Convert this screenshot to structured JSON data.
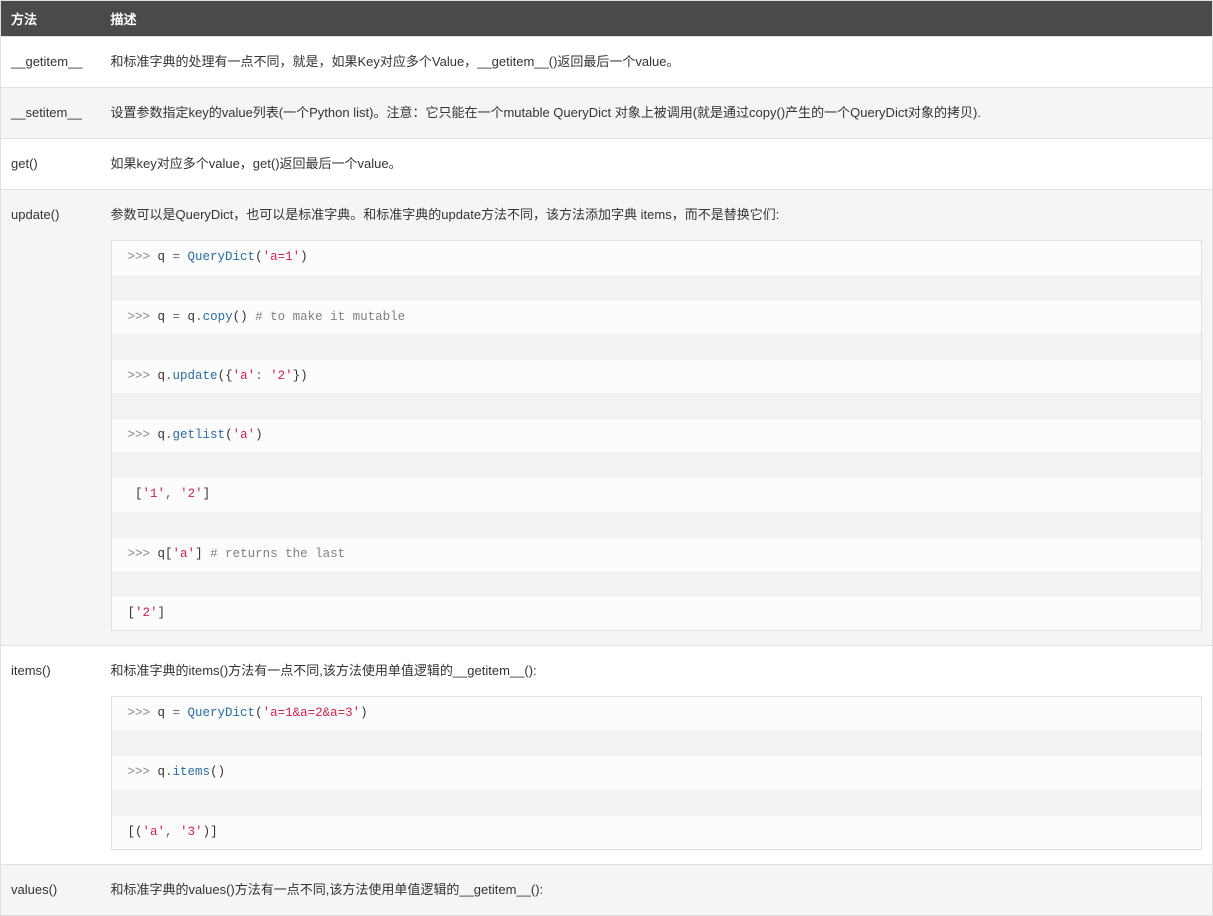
{
  "table": {
    "headers": {
      "method": "方法",
      "desc": "描述"
    },
    "rows": [
      {
        "method": "__getitem__",
        "desc": "和标准字典的处理有一点不同，就是，如果Key对应多个Value，__getitem__()返回最后一个value。"
      },
      {
        "method": "__setitem__",
        "desc": "设置参数指定key的value列表(一个Python list)。注意：它只能在一个mutable QueryDict 对象上被调用(就是通过copy()产生的一个QueryDict对象的拷贝)."
      },
      {
        "method": "get()",
        "desc": "如果key对应多个value，get()返回最后一个value。"
      },
      {
        "method": "update()",
        "desc": "参数可以是QueryDict，也可以是标准字典。和标准字典的update方法不同，该方法添加字典 items，而不是替换它们:"
      },
      {
        "method": "items()",
        "desc": "和标准字典的items()方法有一点不同,该方法使用单值逻辑的__getitem__():"
      },
      {
        "method": "values()",
        "desc": "和标准字典的values()方法有一点不同,该方法使用单值逻辑的__getitem__():"
      }
    ]
  },
  "code_update": {
    "l1": {
      "prompt": ">>> ",
      "v1": "q ",
      "op": "= ",
      "fn": "QueryDict",
      "p1": "(",
      "s1": "'a=1'",
      "p2": ")"
    },
    "l2": {
      "prompt": ">>> ",
      "v1": "q ",
      "op": "= ",
      "v2": "q",
      "dot": ".",
      "fn": "copy",
      "p1": "()",
      "sp": " ",
      "cm": "# to make it mutable"
    },
    "l3": {
      "prompt": ">>> ",
      "v1": "q",
      "dot": ".",
      "fn": "update",
      "p1": "(",
      "br1": "{",
      "s1": "'a'",
      "col": ": ",
      "s2": "'2'",
      "br2": "}",
      "p2": ")"
    },
    "l4": {
      "prompt": ">>> ",
      "v1": "q",
      "dot": ".",
      "fn": "getlist",
      "p1": "(",
      "s1": "'a'",
      "p2": ")"
    },
    "l5": {
      "sp": " ",
      "br1": "[",
      "s1": "'1'",
      "com": ", ",
      "s2": "'2'",
      "br2": "]"
    },
    "l6": {
      "prompt": ">>> ",
      "v1": "q",
      "br1": "[",
      "s1": "'a'",
      "br2": "]",
      "sp": " ",
      "cm": "# returns the last"
    },
    "l7": {
      "br1": "[",
      "s1": "'2'",
      "br2": "]"
    }
  },
  "code_items": {
    "l1": {
      "prompt": ">>> ",
      "v1": "q ",
      "op": "= ",
      "fn": "QueryDict",
      "p1": "(",
      "s1": "'a=1&a=2&a=3'",
      "p2": ")"
    },
    "l2": {
      "prompt": ">>> ",
      "v1": "q",
      "dot": ".",
      "fn": "items",
      "p1": "()"
    },
    "l3": {
      "br1": "[(",
      "s1": "'a'",
      "com": ", ",
      "s2": "'3'",
      "br2": ")]"
    }
  }
}
